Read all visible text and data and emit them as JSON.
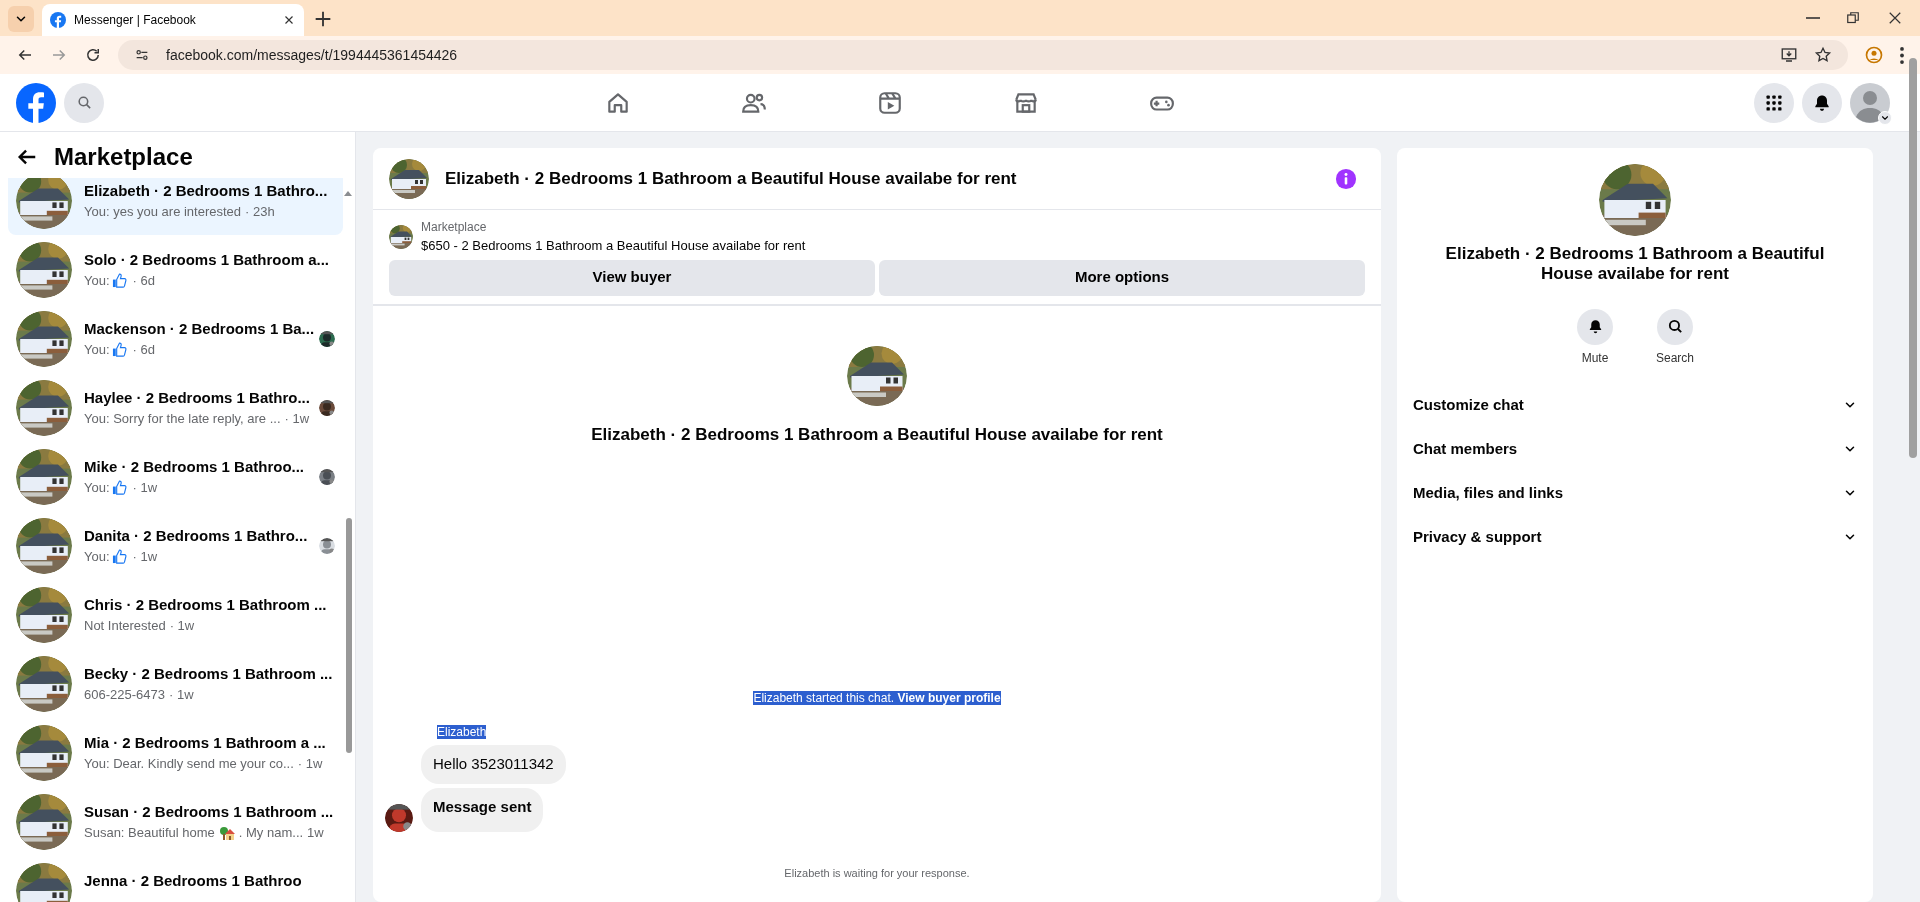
{
  "browser": {
    "tab_title": "Messenger | Facebook",
    "url": "facebook.com/messages/t/1994445361454426"
  },
  "sidebar": {
    "title": "Marketplace",
    "conversations": [
      {
        "name": "Elizabeth · 2 Bedrooms 1 Bathro...",
        "preview": [
          {
            "kind": "text",
            "text": "You: yes you are interested"
          }
        ],
        "time": "· 23h",
        "selected": true,
        "seen_avatar": false
      },
      {
        "name": "Solo · 2 Bedrooms 1 Bathroom a...",
        "preview": [
          {
            "kind": "text",
            "text": "You:"
          },
          {
            "kind": "like"
          }
        ],
        "time": "· 6d",
        "selected": false,
        "seen_avatar": false
      },
      {
        "name": "Mackenson · 2 Bedrooms 1 Ba...",
        "preview": [
          {
            "kind": "text",
            "text": "You:"
          },
          {
            "kind": "like"
          }
        ],
        "time": "· 6d",
        "selected": false,
        "seen_avatar": true
      },
      {
        "name": "Haylee · 2 Bedrooms 1 Bathro...",
        "preview": [
          {
            "kind": "text",
            "text": "You: Sorry for the late reply, are ..."
          }
        ],
        "time": "· 1w",
        "selected": false,
        "seen_avatar": true
      },
      {
        "name": "Mike · 2 Bedrooms 1 Bathroo...",
        "preview": [
          {
            "kind": "text",
            "text": "You:"
          },
          {
            "kind": "like"
          }
        ],
        "time": "· 1w",
        "selected": false,
        "seen_avatar": true
      },
      {
        "name": "Danita · 2 Bedrooms 1 Bathro...",
        "preview": [
          {
            "kind": "text",
            "text": "You:"
          },
          {
            "kind": "like"
          }
        ],
        "time": "· 1w",
        "selected": false,
        "seen_avatar": true
      },
      {
        "name": "Chris · 2 Bedrooms 1 Bathroom ...",
        "preview": [
          {
            "kind": "text",
            "text": "Not Interested"
          }
        ],
        "time": "· 1w",
        "selected": false,
        "seen_avatar": false
      },
      {
        "name": "Becky · 2 Bedrooms 1 Bathroom ...",
        "preview": [
          {
            "kind": "text",
            "text": "606-225-6473"
          }
        ],
        "time": "· 1w",
        "selected": false,
        "seen_avatar": false
      },
      {
        "name": "Mia · 2 Bedrooms 1 Bathroom a ...",
        "preview": [
          {
            "kind": "text",
            "text": "You: Dear. Kindly send me your co..."
          }
        ],
        "time": "· 1w",
        "selected": false,
        "seen_avatar": false
      },
      {
        "name": "Susan · 2 Bedrooms 1 Bathroom ...",
        "preview": [
          {
            "kind": "text",
            "text": "Susan: Beautiful home"
          },
          {
            "kind": "house"
          },
          {
            "kind": "text",
            "text": ". My nam..."
          }
        ],
        "time": "1w",
        "selected": false,
        "seen_avatar": false
      },
      {
        "name": "Jenna · 2 Bedrooms 1 Bathroo",
        "selected": false,
        "seen_avatar": false
      }
    ]
  },
  "chat": {
    "title": "Elizabeth · 2 Bedrooms 1 Bathroom a Beautiful House availabe for rent",
    "listing": {
      "label": "Marketplace",
      "title": "$650 - 2 Bedrooms 1 Bathroom a Beautiful House availabe for rent"
    },
    "buttons": [
      "View buyer",
      "More options"
    ],
    "intro_title": "Elizabeth · 2 Bedrooms 1 Bathroom a Beautiful House availabe for rent",
    "notice": {
      "text": "Elizabeth started this chat.",
      "link": "View buyer profile",
      "highlighted": true
    },
    "sender": {
      "name": "Elizabeth",
      "highlighted": true
    },
    "bubbles": [
      {
        "text": "Hello 3523011342",
        "bold": false
      },
      {
        "text": "Message sent",
        "bold": true
      }
    ],
    "status": "Elizabeth is waiting for your response."
  },
  "details": {
    "title": "Elizabeth · 2 Bedrooms 1 Bathroom a Beautiful House availabe for rent",
    "actions": [
      {
        "kind": "mute",
        "label": "Mute"
      },
      {
        "kind": "search",
        "label": "Search"
      }
    ],
    "sections": [
      {
        "label": "Customize chat",
        "expanded": false
      },
      {
        "label": "Chat members",
        "expanded": false
      },
      {
        "label": "Media, files and links",
        "expanded": false
      },
      {
        "label": "Privacy & support",
        "expanded": false
      }
    ]
  }
}
